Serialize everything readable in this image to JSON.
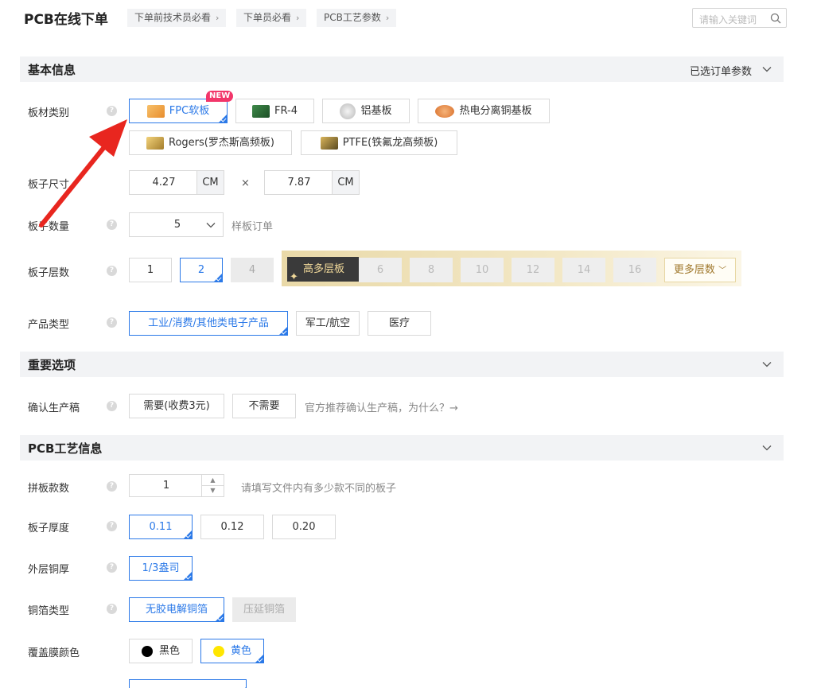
{
  "header": {
    "title": "PCB在线下单",
    "breadcrumbs": [
      {
        "label": "下单前技术员必看"
      },
      {
        "label": "下单员必看"
      },
      {
        "label": "PCB工艺参数"
      }
    ],
    "search_placeholder": "请输入关键词"
  },
  "sections": {
    "basic": {
      "title": "基本信息",
      "right": "已选订单参数"
    },
    "important": {
      "title": "重要选项"
    },
    "process": {
      "title": "PCB工艺信息"
    }
  },
  "material": {
    "label": "板材类别",
    "badge": "NEW",
    "options": [
      {
        "label": "FPC软板"
      },
      {
        "label": "FR-4"
      },
      {
        "label": "铝基板"
      },
      {
        "label": "热电分离铜基板"
      },
      {
        "label": "Rogers(罗杰斯高频板)"
      },
      {
        "label": "PTFE(铁氟龙高频板)"
      }
    ]
  },
  "size": {
    "label": "板子尺寸",
    "width": "4.27",
    "height": "7.87",
    "unit": "CM",
    "times": "×"
  },
  "quantity": {
    "label": "板子数量",
    "value": "5",
    "hint": "样板订单"
  },
  "layers": {
    "label": "板子层数",
    "options": [
      "1",
      "2",
      "4"
    ],
    "multi_badge": "高多层板",
    "multi_options": [
      "6",
      "8",
      "10",
      "12",
      "14",
      "16"
    ],
    "more": "更多层数"
  },
  "product": {
    "label": "产品类型",
    "options": [
      {
        "label": "工业/消费/其他类电子产品"
      },
      {
        "label": "军工/航空"
      },
      {
        "label": "医疗"
      }
    ]
  },
  "confirm": {
    "label": "确认生产稿",
    "options": [
      {
        "label": "需要(收费3元)"
      },
      {
        "label": "不需要"
      }
    ],
    "hint": "官方推荐确认生产稿，为什么？→"
  },
  "panel_count": {
    "label": "拼板款数",
    "value": "1",
    "hint": "请填写文件内有多少款不同的板子"
  },
  "thickness": {
    "label": "板子厚度",
    "options": [
      "0.11",
      "0.12",
      "0.20"
    ]
  },
  "copper": {
    "label": "外层铜厚",
    "options": [
      "1/3盎司"
    ]
  },
  "foil": {
    "label": "铜箔类型",
    "options": [
      "无胶电解铜箔",
      "压延铜箔"
    ]
  },
  "coverlay": {
    "label": "覆盖膜颜色",
    "options": [
      {
        "label": "黑色",
        "color": "#000000"
      },
      {
        "label": "黄色",
        "color": "#ffe600"
      }
    ]
  },
  "colors": {
    "accent": "#2b79e8",
    "annotation_arrow": "#e8261f",
    "new_badge": "#f2366a"
  }
}
